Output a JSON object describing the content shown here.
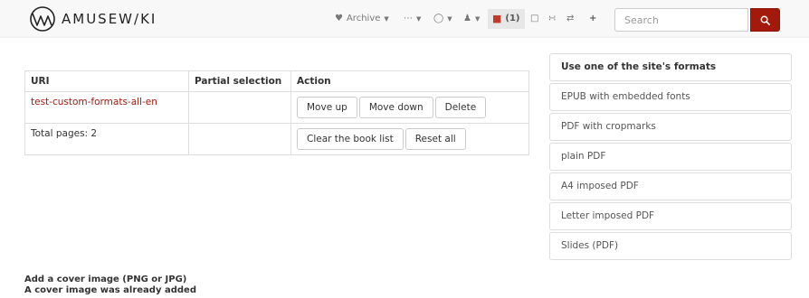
{
  "brand": {
    "logo_text": "AMUSEW/KI"
  },
  "navbar": {
    "archive_label": "Archive",
    "bookbuilder_count": "(1)",
    "search_placeholder": "Search"
  },
  "booklist": {
    "headers": [
      "URI",
      "Partial selection",
      "Action"
    ],
    "rows": [
      {
        "uri": "test-custom-formats-all-en",
        "partial": ""
      }
    ],
    "row_actions": {
      "move_up": "Move up",
      "move_down": "Move down",
      "delete": "Delete"
    },
    "total_label": "Total pages: 2",
    "footer_actions": {
      "clear": "Clear the book list",
      "reset": "Reset all"
    }
  },
  "formats": {
    "header": "Use one of the site's formats",
    "items": [
      "EPUB with embedded fonts",
      "PDF with cropmarks",
      "plain PDF",
      "A4 imposed PDF",
      "Letter imposed PDF",
      "Slides (PDF)"
    ]
  },
  "cover": {
    "title": "Add a cover image (PNG or JPG)",
    "status": "A cover image was already added"
  },
  "colors": {
    "accent": "#a31a0c"
  }
}
